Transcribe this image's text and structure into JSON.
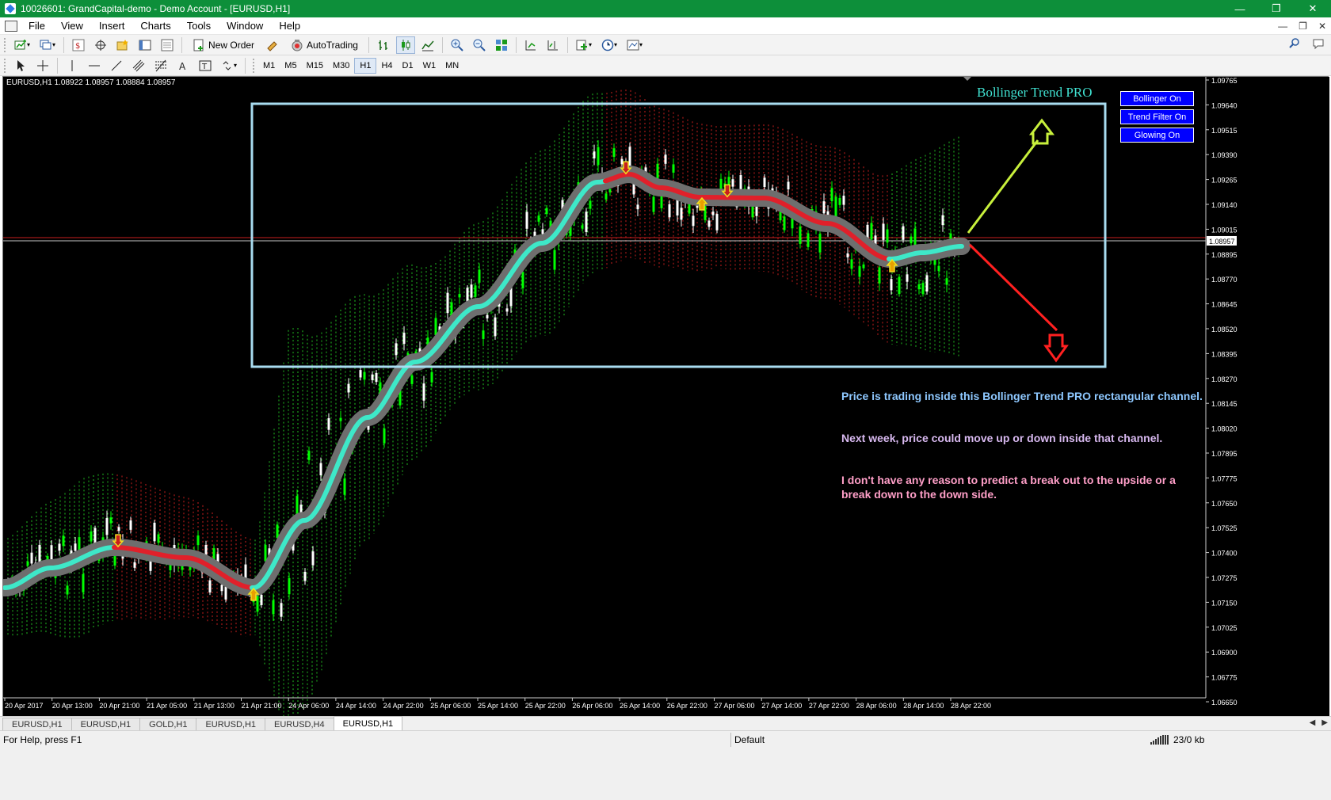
{
  "window": {
    "title": "10026601: GrandCapital-demo - Demo Account - [EURUSD,H1]",
    "buttons": [
      "—",
      "❐",
      "✕"
    ]
  },
  "menu": {
    "items": [
      "File",
      "View",
      "Insert",
      "Charts",
      "Tools",
      "Window",
      "Help"
    ],
    "mdi_buttons": [
      "—",
      "❐",
      "✕"
    ]
  },
  "toolbar": {
    "new_order_label": "New Order",
    "autotrading_label": "AutoTrading"
  },
  "timeframes": [
    "M1",
    "M5",
    "M15",
    "M30",
    "H1",
    "H4",
    "D1",
    "W1",
    "MN"
  ],
  "active_timeframe": "H1",
  "chart": {
    "symbol_info": "EURUSD,H1  1.08922 1.08957 1.08884 1.08957",
    "indicator_title": "Bollinger Trend PRO",
    "panel_buttons": [
      "Bollinger On",
      "Trend Filter On",
      "Glowing On"
    ],
    "current_price": "1.08957",
    "price_axis": [
      "1.09765",
      "1.09640",
      "1.09515",
      "1.09390",
      "1.09265",
      "1.09140",
      "1.09015",
      "1.08895",
      "1.08770",
      "1.08645",
      "1.08520",
      "1.08395",
      "1.08270",
      "1.08145",
      "1.08020",
      "1.07895",
      "1.07775",
      "1.07650",
      "1.07525",
      "1.07400",
      "1.07275",
      "1.07150",
      "1.07025",
      "1.06900",
      "1.06775",
      "1.06650"
    ],
    "time_axis": [
      "20 Apr 2017",
      "20 Apr 13:00",
      "20 Apr 21:00",
      "21 Apr 05:00",
      "21 Apr 13:00",
      "21 Apr 21:00",
      "24 Apr 06:00",
      "24 Apr 14:00",
      "24 Apr 22:00",
      "25 Apr 06:00",
      "25 Apr 14:00",
      "25 Apr 22:00",
      "26 Apr 06:00",
      "26 Apr 14:00",
      "26 Apr 22:00",
      "27 Apr 06:00",
      "27 Apr 14:00",
      "27 Apr 22:00",
      "28 Apr 06:00",
      "28 Apr 14:00",
      "28 Apr 22:00"
    ],
    "annotations": [
      {
        "text": "Price is trading inside this Bollinger Trend  PRO rectangular channel.",
        "color": "#8ec8ff"
      },
      {
        "text": "Next week, price could move up or down inside that channel.",
        "color": "#d8b9f0"
      },
      {
        "text": "I don't have any reason to predict a break out to the upside or a break down to the down side.",
        "color": "#ff9fc8"
      }
    ],
    "colors": {
      "background": "#000000",
      "bull_candle": "#00ff00",
      "bear_candle": "#ffffff",
      "band_up": "#22c022",
      "band_down": "#c81e1e",
      "trend_up": "#3ee8c8",
      "trend_down": "#e0202a",
      "glow": "#6e6e6e",
      "channel_box": "#a8dcf0",
      "arrow_up": "#c8f03c",
      "arrow_down": "#ff2020"
    }
  },
  "tabs": [
    "EURUSD,H1",
    "EURUSD,H1",
    "GOLD,H1",
    "EURUSD,H1",
    "EURUSD,H4",
    "EURUSD,H1"
  ],
  "active_tab_index": 5,
  "status": {
    "help": "For Help, press F1",
    "profile": "Default",
    "connection": "23/0 kb"
  }
}
